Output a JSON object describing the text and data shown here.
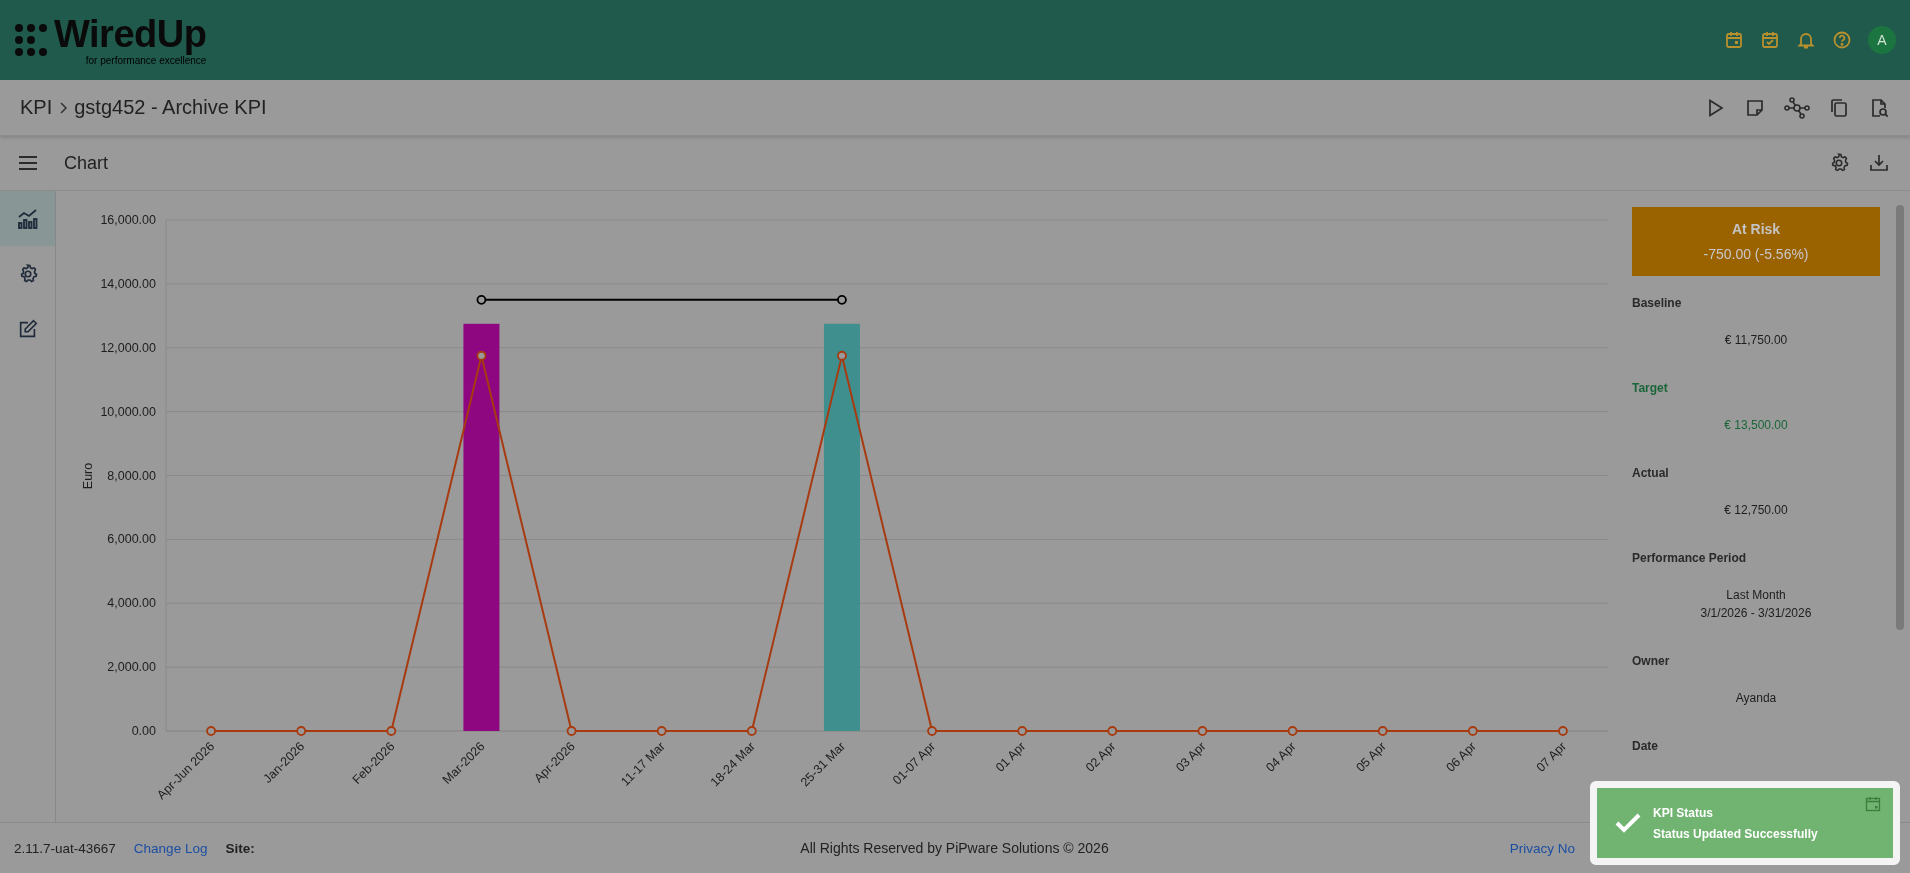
{
  "header": {
    "logo": {
      "name": "WiredUp",
      "tagline": "for performance excellence"
    },
    "avatar": "A"
  },
  "breadcrumb": [
    {
      "label": "KPI"
    },
    {
      "label": "gstg452 - Archive KPI"
    }
  ],
  "toolbar": {
    "title": "Chart"
  },
  "side_rail": [
    {
      "kind": "chart",
      "selected": true
    },
    {
      "kind": "settings",
      "selected": false
    },
    {
      "kind": "edit",
      "selected": false
    }
  ],
  "chart_data": {
    "type": "bar",
    "ylabel": "Euro",
    "categories": [
      "Apr-Jun 2026",
      "Jan-2026",
      "Feb-2026",
      "Mar-2026",
      "Apr-2026",
      "11-17 Mar",
      "18-24 Mar",
      "25-31 Mar",
      "01-07 Apr",
      "01 Apr",
      "02 Apr",
      "03 Apr",
      "04 Apr",
      "05 Apr",
      "06 Apr",
      "07 Apr"
    ],
    "series": [
      {
        "type": "bar",
        "color": "#8e0780",
        "values": [
          null,
          null,
          null,
          12750,
          null,
          null,
          null,
          null,
          null,
          null,
          null,
          null,
          null,
          null,
          null,
          null
        ]
      },
      {
        "type": "bar",
        "color": "#3f8f8f",
        "values": [
          null,
          null,
          null,
          null,
          null,
          null,
          null,
          12750,
          null,
          null,
          null,
          null,
          null,
          null,
          null,
          null
        ]
      },
      {
        "type": "line",
        "color": "#a83a10",
        "marker": "circle",
        "values": [
          0,
          0,
          0,
          11750,
          0,
          0,
          0,
          11750,
          0,
          0,
          0,
          0,
          0,
          0,
          0,
          0
        ]
      },
      {
        "type": "line",
        "color": "#000000",
        "marker": "circle",
        "values": [
          null,
          null,
          null,
          13500,
          null,
          null,
          null,
          13500,
          null,
          null,
          null,
          null,
          null,
          null,
          null,
          null
        ]
      }
    ],
    "grid": true,
    "ylim": [
      0,
      16000
    ],
    "yticks": [
      {
        "value": 0,
        "label": "0.00"
      },
      {
        "value": 2000,
        "label": "2,000.00"
      },
      {
        "value": 4000,
        "label": "4,000.00"
      },
      {
        "value": 6000,
        "label": "6,000.00"
      },
      {
        "value": 8000,
        "label": "8,000.00"
      },
      {
        "value": 10000,
        "label": "10,000.00"
      },
      {
        "value": 12000,
        "label": "12,000.00"
      },
      {
        "value": 14000,
        "label": "14,000.00"
      },
      {
        "value": 16000,
        "label": "16,000.00"
      }
    ]
  },
  "status_card": {
    "title": "At Risk",
    "value": "-750.00 (-5.56%)"
  },
  "details": [
    {
      "label": "Baseline",
      "lines": [
        "€ 11,750.00"
      ],
      "highlight": false
    },
    {
      "label": "Target",
      "lines": [
        "€ 13,500.00"
      ],
      "highlight": true
    },
    {
      "label": "Actual",
      "lines": [
        "€ 12,750.00"
      ],
      "highlight": false
    },
    {
      "label": "Performance Period",
      "lines": [
        "Last Month",
        "3/1/2026 - 3/31/2026"
      ],
      "highlight": false
    },
    {
      "label": "Owner",
      "lines": [
        "Ayanda"
      ],
      "highlight": false
    },
    {
      "label": "Date",
      "highlight": false
    }
  ],
  "footer": {
    "version": "2.11.7-uat-43667",
    "changelog": "Change Log",
    "site_label": "Site:",
    "copyright": "All Rights Reserved by PiPware Solutions © 2026",
    "links": [
      {
        "label": "Privacy No"
      }
    ]
  },
  "toast": {
    "title": "KPI Status",
    "message": "Status Updated Successfully"
  }
}
